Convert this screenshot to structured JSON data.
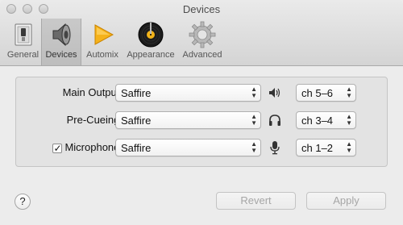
{
  "window": {
    "title": "Devices"
  },
  "toolbar": {
    "items": [
      {
        "label": "General",
        "icon": "switch-icon",
        "selected": false
      },
      {
        "label": "Devices",
        "icon": "speaker-icon",
        "selected": true
      },
      {
        "label": "Automix",
        "icon": "play-icon",
        "selected": false
      },
      {
        "label": "Appearance",
        "icon": "record-icon",
        "selected": false
      },
      {
        "label": "Advanced",
        "icon": "gear-icon",
        "selected": false
      }
    ]
  },
  "rows": [
    {
      "label": "Main Output:",
      "device": "Saffire",
      "icon": "speaker-volume-icon",
      "channel": "ch 5–6"
    },
    {
      "label": "Pre-Cueing:",
      "device": "Saffire",
      "icon": "headphones-icon",
      "channel": "ch 3–4"
    },
    {
      "label": "Microphone:",
      "checked": true,
      "checkmark": "✓",
      "device": "Saffire",
      "icon": "microphone-icon",
      "channel": "ch 1–2"
    }
  ],
  "footer": {
    "help": "?",
    "revert": "Revert",
    "apply": "Apply"
  }
}
